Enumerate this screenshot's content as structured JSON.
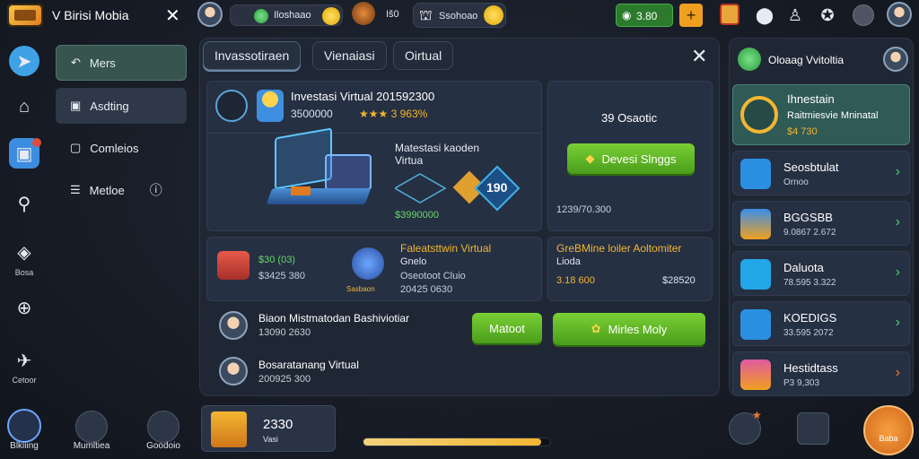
{
  "topbar": {
    "app_title": "V Birisi Mobia",
    "pill1_text": "Iloshaao",
    "pill2_text": "Iš0",
    "pill3_text": "Ssohoao",
    "balance": "3.80"
  },
  "left_rail": {
    "items": [
      {
        "label": ""
      },
      {
        "label": ""
      },
      {
        "label": ""
      },
      {
        "label": ""
      },
      {
        "label": "Bosa"
      },
      {
        "label": ""
      },
      {
        "label": "Cetoor"
      }
    ]
  },
  "nav": {
    "items": [
      {
        "label": "Mers"
      },
      {
        "label": "Asdting"
      },
      {
        "label": "Comleios"
      },
      {
        "label": "Metloe"
      }
    ]
  },
  "main": {
    "tabs": [
      {
        "label": "Invassotiraen"
      },
      {
        "label": "Vienaiasi"
      },
      {
        "label": "Oirtual"
      }
    ],
    "featured": {
      "title": "Investasi Virtual 201592300",
      "value": "3500000",
      "rating_text": "★★★ 3 963%",
      "label": "Matestasi kaoden Virtua",
      "amount": "$3990000",
      "badge": "190"
    },
    "side_card": {
      "text": "39 Osaotic",
      "button_label": "Devesi Slnggs",
      "footer": "1239/70.300"
    },
    "row2_left": {
      "title": "$30 (03)",
      "sub": "$3425 380",
      "heading": "Faleatsttwin Virtual",
      "line1": "Gnelo",
      "line2": "Oseotoot Cluio",
      "line3": "20425 0630",
      "mini_label": "Sasbaon"
    },
    "row2_right": {
      "title": "GreBMine loiler Aoltomiter",
      "sub": "Lioda",
      "left_val": "3.18 600",
      "right_val": "$28520"
    },
    "list": [
      {
        "title": "Biaon Mistmatodan Bashiviotiar",
        "sub": "13090 2630"
      },
      {
        "title": "Bosaratanang Virtual",
        "sub": "200925 300"
      }
    ],
    "btn_small_label": "Matoot",
    "btn_large_label": "Mirles Moly"
  },
  "right_panel": {
    "header_label": "Oloaag Vvitoltia",
    "featured": {
      "title": "Ihnestain",
      "sub": "Raitmiesvie Mninatal",
      "amount": "$4 730"
    },
    "items": [
      {
        "title": "Seosbtulat",
        "sub": "Ornoo"
      },
      {
        "title": "BGGSBB",
        "sub": "9.0867 2.672"
      },
      {
        "title": "Daluota",
        "sub": "78.595 3.322"
      },
      {
        "title": "KOEDIGS",
        "sub": "33.595 2072"
      },
      {
        "title": "Hestidtass",
        "sub": "P3 9,303"
      }
    ]
  },
  "bottom": {
    "items": [
      {
        "label": "Blkiiing"
      },
      {
        "label": "Mumltiea"
      },
      {
        "label": "Goodoio"
      }
    ],
    "wallet_value": "2330",
    "wallet_label": "Vasi",
    "progress": 0.95,
    "right_label": "Baba"
  },
  "colors": {
    "accent_green": "#4a9d1b",
    "gold": "#f2b632",
    "teal_active": "#38544f"
  }
}
